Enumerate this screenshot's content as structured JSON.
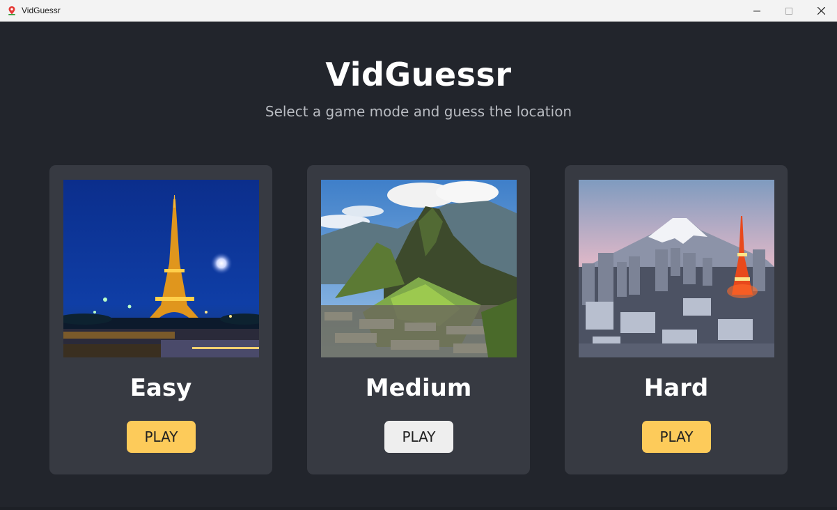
{
  "window": {
    "title": "VidGuessr",
    "app_icon": "map-pin-icon",
    "controls": [
      "minimize-icon",
      "maximize-icon",
      "close-icon"
    ]
  },
  "header": {
    "title": "VidGuessr",
    "subtitle": "Select a game mode and guess the location"
  },
  "modes": [
    {
      "title": "Easy",
      "play_label": "PLAY",
      "image": "eiffel-tower-night-photo",
      "button_color": "#fdcb5a"
    },
    {
      "title": "Medium",
      "play_label": "PLAY",
      "image": "machu-picchu-photo",
      "button_color": "#eeeeee"
    },
    {
      "title": "Hard",
      "play_label": "PLAY",
      "image": "tokyo-mount-fuji-photo",
      "button_color": "#fdcb5a"
    }
  ],
  "colors": {
    "background": "#22252c",
    "card": "#373a42",
    "accent": "#fdcb5a"
  }
}
